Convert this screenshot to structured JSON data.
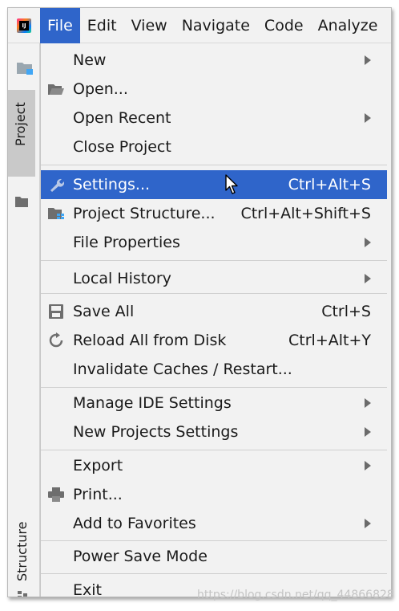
{
  "menubar": {
    "items": [
      {
        "label": "File"
      },
      {
        "label": "Edit"
      },
      {
        "label": "View"
      },
      {
        "label": "Navigate"
      },
      {
        "label": "Code"
      },
      {
        "label": "Analyze"
      }
    ]
  },
  "sidebar": {
    "project_tab": "Project",
    "structure_tab": "Structure"
  },
  "file_menu": {
    "new": "New",
    "open": "Open...",
    "open_recent": "Open Recent",
    "close_project": "Close Project",
    "settings": "Settings...",
    "settings_shortcut": "Ctrl+Alt+S",
    "project_structure": "Project Structure...",
    "project_structure_shortcut": "Ctrl+Alt+Shift+S",
    "file_properties": "File Properties",
    "local_history": "Local History",
    "save_all": "Save All",
    "save_all_shortcut": "Ctrl+S",
    "reload_all": "Reload All from Disk",
    "reload_all_shortcut": "Ctrl+Alt+Y",
    "invalidate_caches": "Invalidate Caches / Restart...",
    "manage_ide_settings": "Manage IDE Settings",
    "new_projects_settings": "New Projects Settings",
    "export": "Export",
    "print": "Print...",
    "add_to_favorites": "Add to Favorites",
    "power_save_mode": "Power Save Mode",
    "exit": "Exit"
  },
  "colors": {
    "selection": "#2f65ca",
    "menu_bg": "#f2f2f2"
  },
  "watermark": "https://blog.csdn.net/qq_44866828"
}
